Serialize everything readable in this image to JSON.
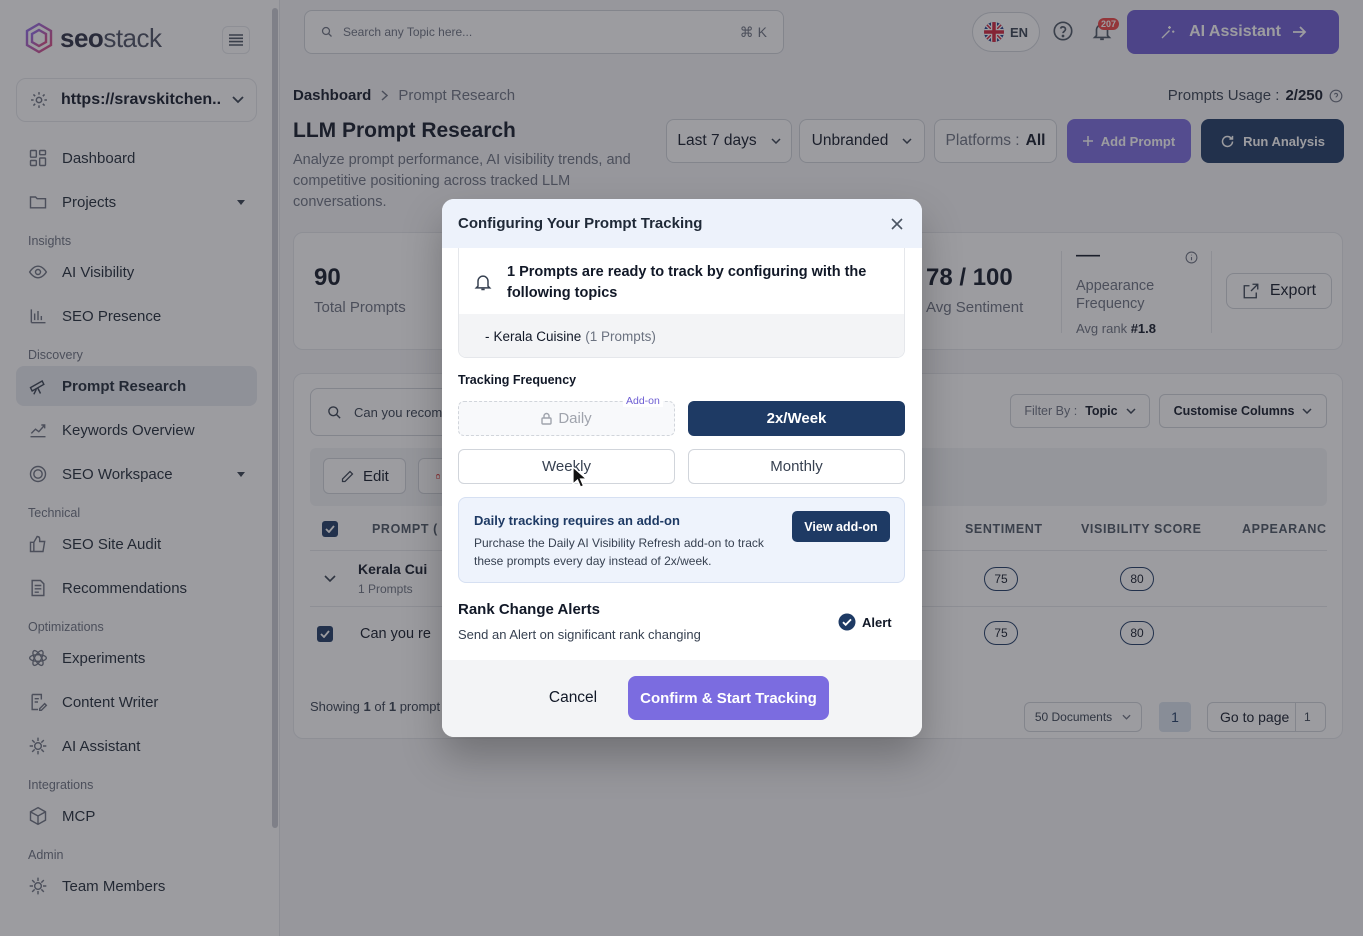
{
  "brand": {
    "name_bold": "seo",
    "name_light": "stack"
  },
  "sidebar": {
    "site": "https://sravskitchen....",
    "sections": [
      {
        "label": "",
        "items": [
          {
            "label": "Dashboard",
            "icon": "dashboard-icon"
          },
          {
            "label": "Projects",
            "icon": "folder-icon",
            "caret": true
          }
        ]
      },
      {
        "label": "Insights",
        "items": [
          {
            "label": "AI Visibility",
            "icon": "eye-icon"
          },
          {
            "label": "SEO Presence",
            "icon": "bar-chart-icon"
          }
        ]
      },
      {
        "label": "Discovery",
        "items": [
          {
            "label": "Prompt Research",
            "icon": "telescope-icon",
            "active": true
          },
          {
            "label": "Keywords Overview",
            "icon": "trend-icon"
          },
          {
            "label": "SEO Workspace",
            "icon": "target-icon",
            "caret": true
          }
        ]
      },
      {
        "label": "Technical",
        "items": [
          {
            "label": "SEO Site Audit",
            "icon": "thumbs-up-icon"
          },
          {
            "label": "Recommendations",
            "icon": "document-icon"
          }
        ]
      },
      {
        "label": "Optimizations",
        "items": [
          {
            "label": "Experiments",
            "icon": "atom-icon"
          },
          {
            "label": "Content Writer",
            "icon": "pen-doc-icon"
          },
          {
            "label": "AI Assistant",
            "icon": "ai-cog-icon"
          }
        ]
      },
      {
        "label": "Integrations",
        "items": [
          {
            "label": "MCP",
            "icon": "cube-icon"
          }
        ]
      },
      {
        "label": "Admin",
        "items": [
          {
            "label": "Team Members",
            "icon": "team-cog-icon"
          }
        ]
      }
    ]
  },
  "topbar": {
    "search_placeholder": "Search any Topic here...",
    "shortcut": "⌘ K",
    "language": "EN",
    "notification_count": "207",
    "ai_button": "AI Assistant"
  },
  "page": {
    "breadcrumb_root": "Dashboard",
    "breadcrumb_current": "Prompt Research",
    "usage_label": "Prompts Usage :",
    "usage_value": "2/250",
    "title": "LLM Prompt Research",
    "subtitle": "Analyze prompt performance, AI visibility trends, and competitive positioning across tracked LLM conversations.",
    "filters": {
      "range": "Last 7 days",
      "brand": "Unbranded",
      "platforms_label": "Platforms :",
      "platforms_value": "All"
    },
    "add_prompt": "Add Prompt",
    "run_analysis": "Run Analysis"
  },
  "stats": {
    "total_prompts_value": "90",
    "total_prompts_label": "Total Prompts",
    "sentiment_value": "78 / 100",
    "sentiment_label": "Avg Sentiment",
    "appearance_value": "—",
    "appearance_label": "Appearance Frequency",
    "avg_rank_label": "Avg rank",
    "avg_rank_value": "#1.8",
    "export": "Export"
  },
  "table": {
    "search_value": "Can you recomm",
    "filter_by_label": "Filter By :",
    "filter_by_value": "Topic",
    "customise": "Customise Columns",
    "edit": "Edit",
    "headers": {
      "prompt": "PROMPT (",
      "sentiment": "SENTIMENT",
      "visibility": "VISIBILITY SCORE",
      "appearance": "APPEARANC"
    },
    "group_row": {
      "title": "Kerala Cui",
      "sub": "1 Prompts",
      "sentiment": "75",
      "visibility": "80"
    },
    "prompt_row": {
      "title": "Can you re",
      "sentiment": "75",
      "visibility": "80"
    },
    "showing_prefix": "Showing",
    "showing_from": "1",
    "showing_of": "of",
    "showing_total": "1",
    "showing_suffix": "prompt",
    "docs": "50 Documents",
    "current_page": "1",
    "go_to_page": "Go to page",
    "go_to_value": "1"
  },
  "modal": {
    "title": "Configuring Your Prompt Tracking",
    "ready_message": "1 Prompts are ready to track by configuring with the following topics",
    "topic_prefix": "-",
    "topic_name": "Kerala Cuisine",
    "topic_count": "(1 Prompts)",
    "frequency_label": "Tracking Frequency",
    "addon_tag": "Add-on",
    "frequency_options": {
      "daily": "Daily",
      "twice_week": "2x/Week",
      "weekly": "Weekly",
      "monthly": "Monthly"
    },
    "selected_frequency": "2x/Week",
    "info_title": "Daily tracking requires an add-on",
    "info_text": "Purchase the Daily AI Visibility Refresh add-on to track these prompts every day instead of 2x/week.",
    "view_addon": "View add-on",
    "alerts_title": "Rank Change Alerts",
    "alerts_sub": "Send an Alert on significant rank changing",
    "alert_label": "Alert",
    "alert_checked": true,
    "cancel": "Cancel",
    "confirm": "Confirm & Start Tracking"
  },
  "colors": {
    "primary_navy": "#1e3a64",
    "accent_purple": "#7b6ce0"
  }
}
